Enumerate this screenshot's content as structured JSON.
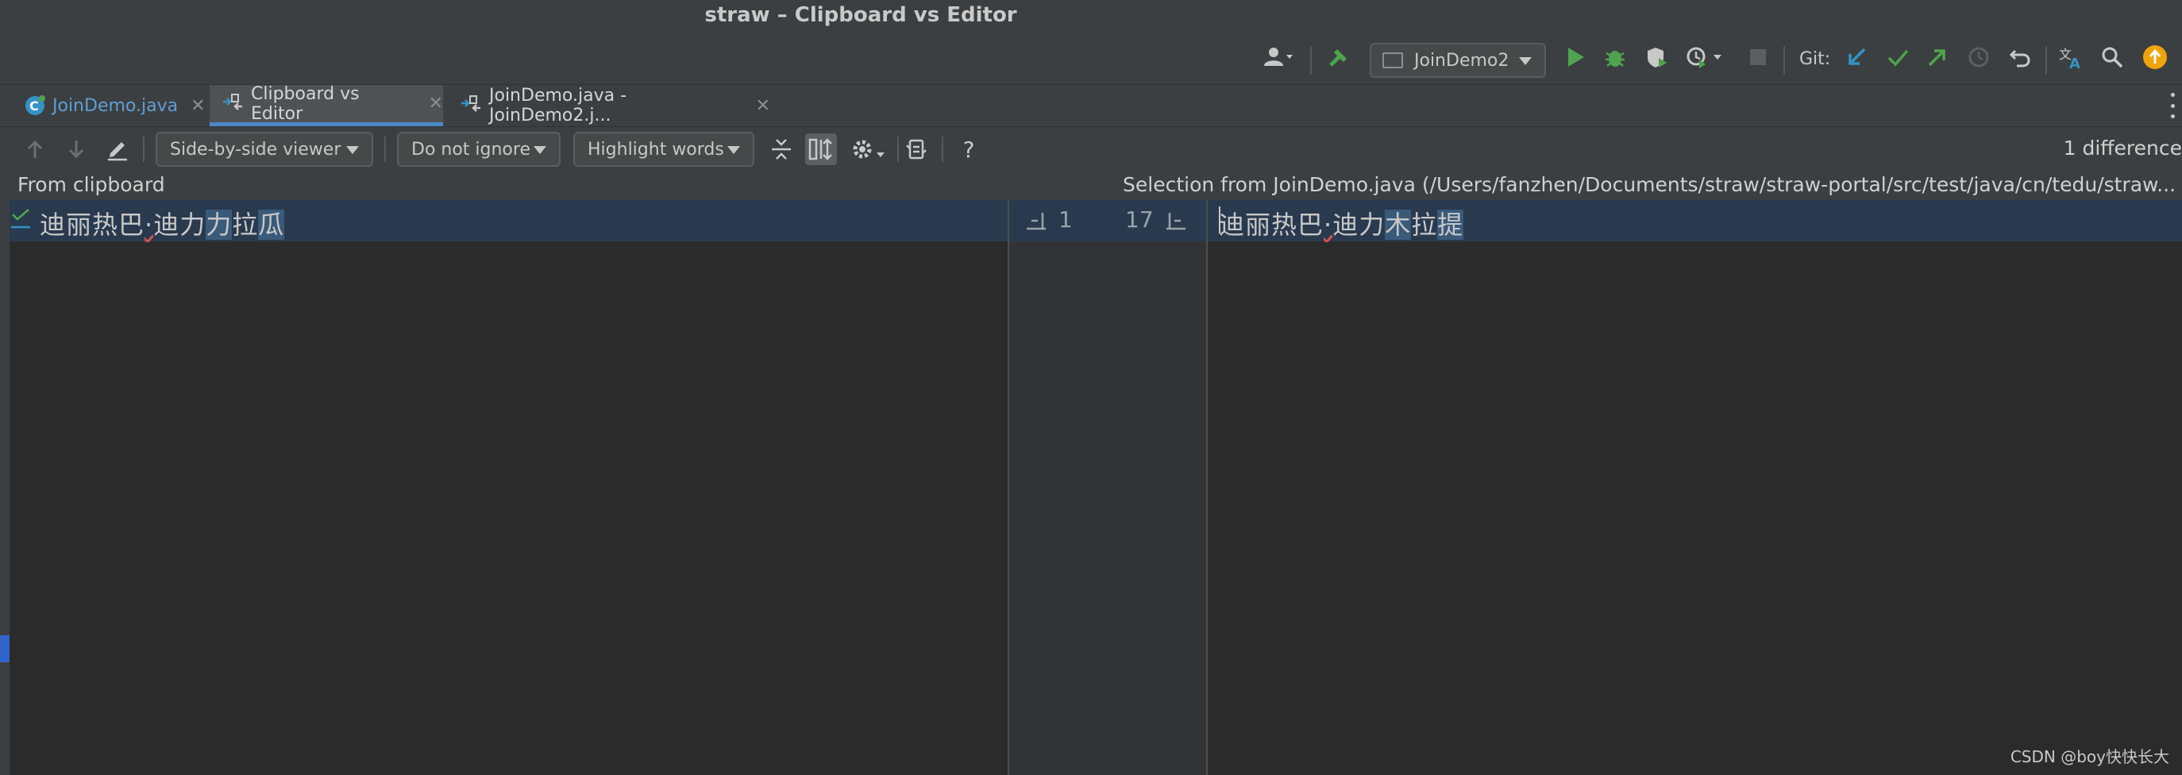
{
  "window": {
    "title": "straw – Clipboard vs Editor"
  },
  "toolbar": {
    "run_config": "JoinDemo2",
    "git_label": "Git:"
  },
  "tabs": [
    {
      "label": "JoinDemo.java",
      "active": false
    },
    {
      "label": "Clipboard vs Editor",
      "active": true
    },
    {
      "label": "JoinDemo.java - JoinDemo2.j...",
      "active": false
    }
  ],
  "diff_toolbar": {
    "viewer": "Side-by-side viewer",
    "ignore": "Do not ignore",
    "highlight": "Highlight words",
    "help": "?",
    "count": "1 difference"
  },
  "left_pane": {
    "header": "From clipboard",
    "line_parts": [
      "迪丽热巴",
      "·",
      "迪力",
      "力",
      "拉",
      "瓜"
    ],
    "line_number": "1"
  },
  "right_pane": {
    "header": "Selection from JoinDemo.java (/Users/fanzhen/Documents/straw/straw-portal/src/test/java/cn/tedu/straw...",
    "line_parts": [
      "迪丽热巴",
      "·",
      "迪力",
      "木",
      "拉",
      "提"
    ],
    "line_number": "17"
  },
  "colors": {
    "accent": "#4a88c7",
    "changed_line_bg": "#293a4f",
    "word_highlight": "#3a5a7a",
    "run_green": "#4fa34f"
  },
  "watermark": "CSDN @boy快快长大"
}
